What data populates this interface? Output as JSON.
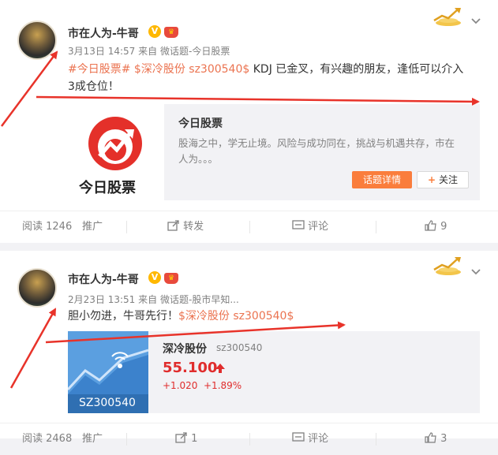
{
  "colors": {
    "topic": "#eb7350",
    "up": "#e02d2d",
    "arrow": "#e8332a",
    "orange_button": "#fa7d3c"
  },
  "post1": {
    "author": "市在人为-牛哥",
    "verified_badge": "V",
    "time": "3月13日 14:57",
    "source_prefix": "来自",
    "source": "微话题-今日股票",
    "topic_tag": "#今日股票#",
    "stock_tag": "$深冷股份 sz300540$",
    "text_rest": " KDJ 已金叉，有兴趣的朋友，逢低可以介入",
    "text_line2": "3成仓位！",
    "link_card": {
      "logo_text": "今日股票",
      "title": "今日股票",
      "desc_line1": "股海之中，学无止境。风险与成功同在，挑战与机遇共存，市在",
      "desc_line2": "人为。。。",
      "detail_button": "话题详情",
      "follow_icon": "plus-icon",
      "follow_button": "关注"
    },
    "actions": {
      "read_label": "阅读 1246",
      "promote": "推广",
      "repost": "转发",
      "comment": "评论",
      "like_count": "9"
    }
  },
  "post2": {
    "author": "市在人为-牛哥",
    "verified_badge": "V",
    "time": "2月23日 13:51",
    "source_prefix": "来自",
    "source": "微话题-股市早知...",
    "text_plain": "胆小勿进，牛哥先行！",
    "stock_tag": "$深冷股份 sz300540$",
    "stock_card": {
      "image_code": "SZ300540",
      "name": "深冷股份",
      "code": "sz300540",
      "price": "55.100",
      "change": "+1.020",
      "change_pct": "+1.89%"
    },
    "actions": {
      "read_label": "阅读 2468",
      "promote": "推广",
      "repost_count": "1",
      "comment": "评论",
      "like_count": "3"
    }
  }
}
